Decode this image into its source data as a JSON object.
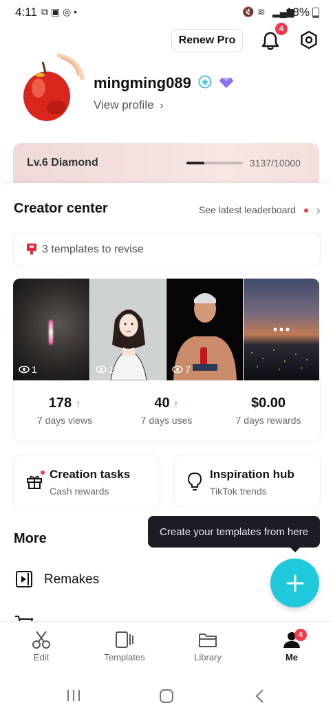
{
  "status_bar": {
    "time": "4:11",
    "battery": "18%"
  },
  "header": {
    "renew_label": "Renew Pro",
    "notification_count": "4"
  },
  "profile": {
    "username": "mingming089",
    "view_profile": "View profile"
  },
  "level": {
    "label": "Lv.6 Diamond",
    "points": "3137/10000",
    "progress_fraction": 0.3137
  },
  "creator_center": {
    "title": "Creator center",
    "leaderboard_link": "See latest leaderboard",
    "revise_text": "3 templates to revise",
    "thumbnails": [
      {
        "count": "1"
      },
      {
        "count": "1"
      },
      {
        "count": "7"
      },
      {
        "count": ""
      }
    ],
    "stats": [
      {
        "value": "178",
        "label": "7 days views"
      },
      {
        "value": "40",
        "label": "7 days uses"
      },
      {
        "value": "$0.00",
        "label": "7 days rewards"
      }
    ]
  },
  "cards": [
    {
      "title": "Creation tasks",
      "subtitle": "Cash rewards"
    },
    {
      "title": "Inspiration hub",
      "subtitle": "TikTok trends"
    }
  ],
  "more": {
    "title": "More",
    "items": [
      {
        "label": "Remakes"
      }
    ]
  },
  "tooltip": {
    "text": "Create your templates from here"
  },
  "nav": {
    "items": [
      {
        "label": "Edit"
      },
      {
        "label": "Templates"
      },
      {
        "label": "Library"
      },
      {
        "label": "Me"
      }
    ],
    "me_badge": "4"
  },
  "colors": {
    "accent": "#20c8dc",
    "badge": "#f43a4a",
    "up_arrow": "#1db36b"
  }
}
